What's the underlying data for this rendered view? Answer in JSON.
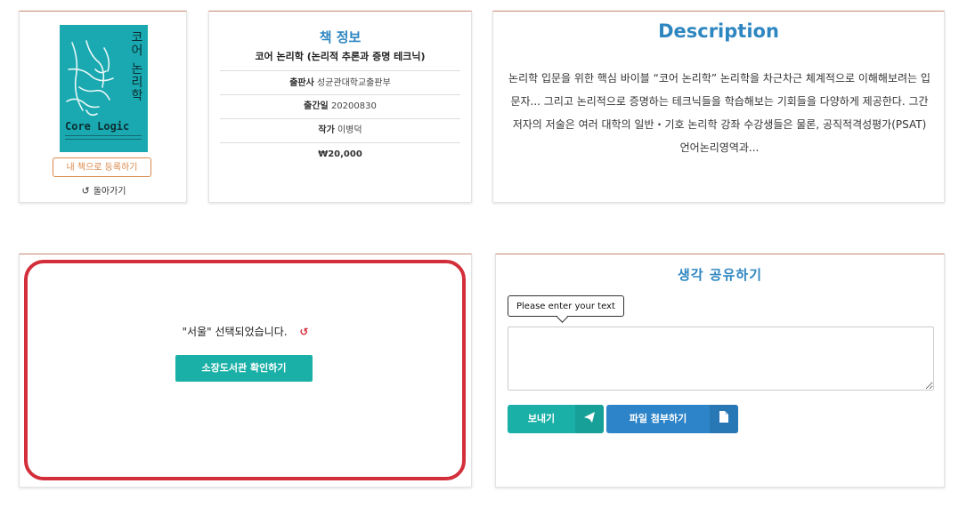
{
  "book": {
    "cover": {
      "title_kr": "코어 논리학",
      "title_en": "Core Logic",
      "color": "#1aa9b0"
    },
    "register_label": "내 책으로 등록하기",
    "back_icon": "undo-icon",
    "back_label": "돌아가기"
  },
  "info": {
    "heading": "책 정보",
    "title": "코어 논리학 (논리적 추론과 증명 테크닉)",
    "publisher_label": "출판사",
    "publisher": "성균관대학교출판부",
    "date_label": "출간일",
    "date": "20200830",
    "author_label": "작가",
    "author": "이병덕",
    "price": "₩20,000"
  },
  "description": {
    "heading": "Description",
    "text": "논리학 입문을 위한 핵심 바이블 “코어 논리학” 논리학을 차근차근 체계적으로 이해해보려는 입문자... 그리고 논리적으로 증명하는 테크닉들을 학습해보는 기회들을 다양하게 제공한다. 그간 저자의 저술은 여러 대학의 일반・기호 논리학 강좌 수강생들은 물론, 공직적격성평가(PSAT) 언어논리영역과..."
  },
  "library": {
    "selected_message": "\"서울\" 선택되었습니다.",
    "reset_icon": "refresh-icon",
    "check_button": "소장도서관 확인하기",
    "highlight_color": "#d32f3b"
  },
  "share": {
    "heading": "생각 공유하기",
    "tooltip": "Please enter your text",
    "textarea_value": "",
    "send_label": "보내기",
    "send_icon": "paper-plane-icon",
    "attach_label": "파일 첨부하기",
    "attach_icon": "file-icon",
    "accent_color": "#1ab0a7",
    "attach_color": "#2d84c8"
  }
}
